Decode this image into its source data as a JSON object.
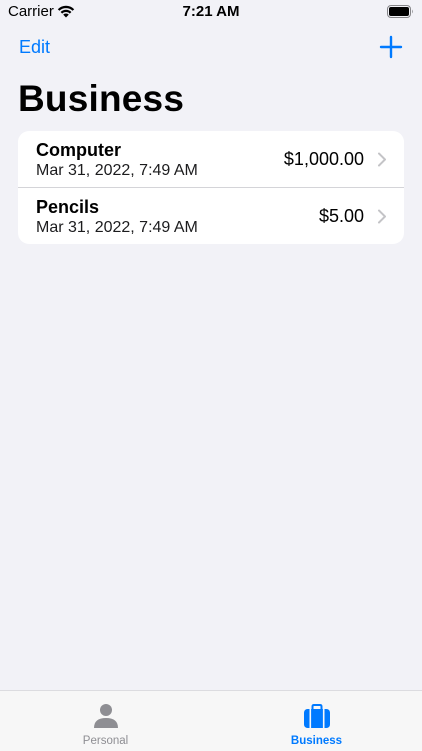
{
  "status_bar": {
    "carrier": "Carrier",
    "time": "7:21 AM"
  },
  "nav": {
    "edit_label": "Edit",
    "add_icon": "plus-icon"
  },
  "title": "Business",
  "items": [
    {
      "name": "Computer",
      "date": "Mar 31, 2022, 7:49 AM",
      "amount": "$1,000.00"
    },
    {
      "name": "Pencils",
      "date": "Mar 31, 2022, 7:49 AM",
      "amount": "$5.00"
    }
  ],
  "tabs": [
    {
      "label": "Personal",
      "icon": "person-icon",
      "selected": false
    },
    {
      "label": "Business",
      "icon": "briefcase-icon",
      "selected": true
    }
  ],
  "colors": {
    "accent": "#007aff",
    "background": "#f2f2f7",
    "inactive": "#8e8e93"
  }
}
